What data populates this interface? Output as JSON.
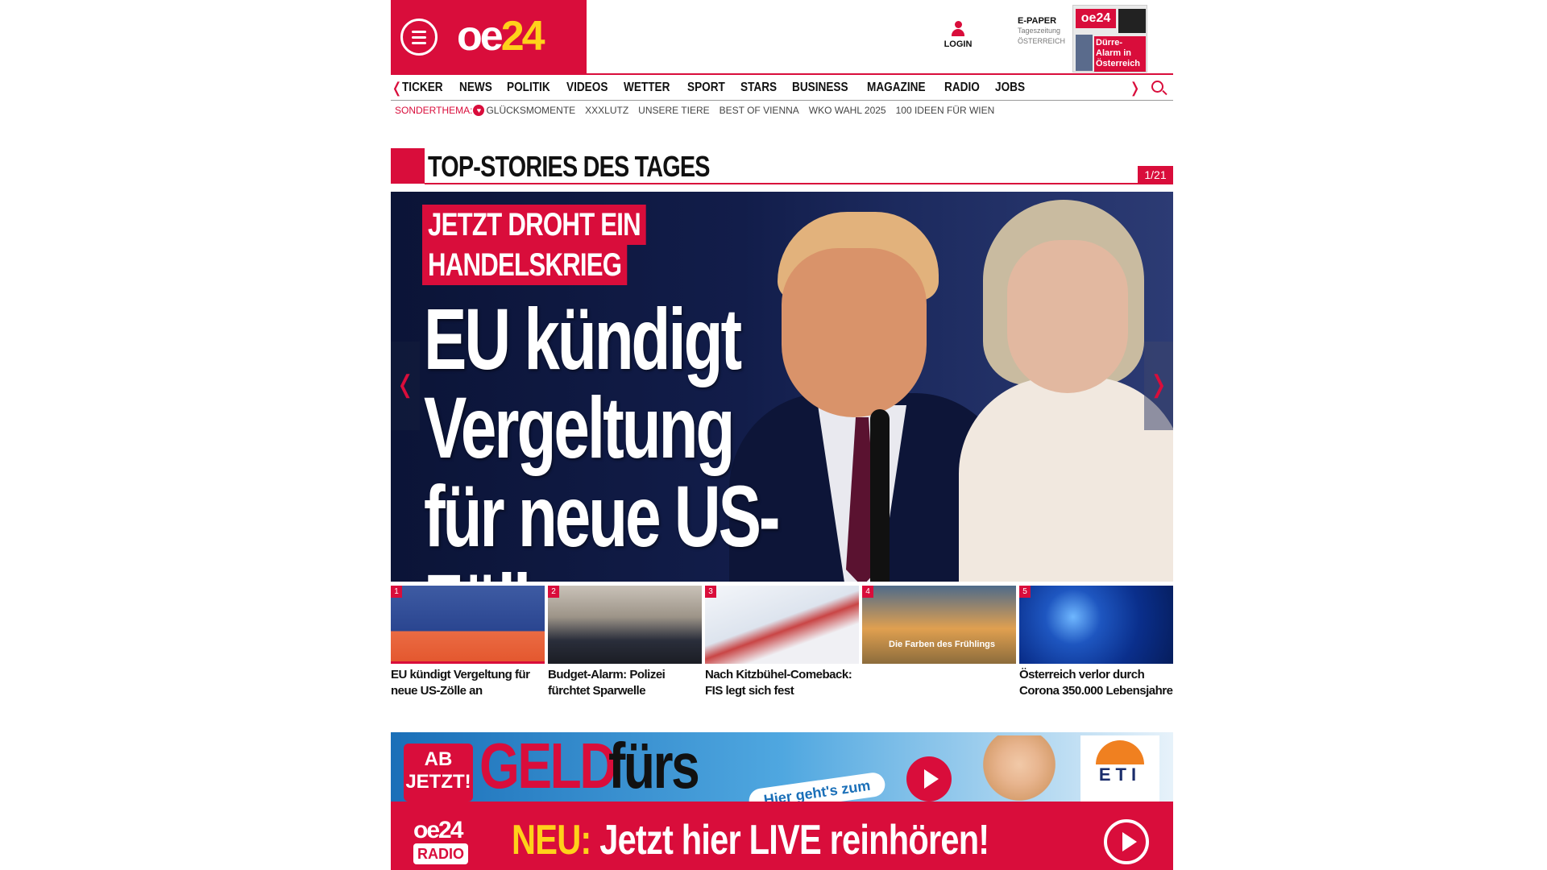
{
  "brand": {
    "logo_oe": "oe",
    "logo_24": "24"
  },
  "header": {
    "login_label": "LOGIN",
    "epaper": {
      "title": "E-PAPER",
      "line1": "Tageszeitung",
      "line2": "ÖSTERREICH",
      "cover_logo": "oe24",
      "cover_headline": "Dürre-Alarm in Österreich"
    }
  },
  "nav": {
    "items": [
      "TICKER",
      "NEWS",
      "POLITIK",
      "VIDEOS",
      "WETTER",
      "SPORT",
      "STARS",
      "BUSINESS",
      "MAGAZINE",
      "RADIO",
      "JOBS"
    ]
  },
  "subnav": {
    "label": "SONDERTHEMA:",
    "items": [
      "GLÜCKSMOMENTE",
      "XXXLUTZ",
      "UNSERE TIERE",
      "BEST OF VIENNA",
      "WKO WAHL 2025",
      "100 IDEEN FÜR WIEN"
    ]
  },
  "top_stories": {
    "title": "TOP-STORIES DES TAGES",
    "counter": "1/21",
    "hero": {
      "kicker_line1": "JETZT DROHT EIN",
      "kicker_line2": "HANDELSKRIEG",
      "headline": "EU kündigt Vergeltung für neue US-Zölle an"
    },
    "teasers": [
      {
        "num": "1",
        "caption": "EU kündigt Vergeltung für neue US-Zölle an",
        "image_text": ""
      },
      {
        "num": "2",
        "caption": "Budget-Alarm: Polizei fürchtet Sparwelle",
        "image_text": ""
      },
      {
        "num": "3",
        "caption": "Nach Kitzbühel-Comeback: FIS legt sich fest",
        "image_text": ""
      },
      {
        "num": "4",
        "caption": "",
        "image_text": "Die Farben des Frühlings"
      },
      {
        "num": "5",
        "caption": "Österreich verlor durch Corona 350.000 Lebensjahre",
        "image_text": ""
      }
    ]
  },
  "ads": {
    "ad1": {
      "badge": "AB JETZT!",
      "word1": "GELD",
      "word2": "fürs",
      "pill": "Hier geht's zum",
      "brand": "ETI"
    },
    "ad2": {
      "logo": "oe24",
      "logo_sub": "RADIO",
      "neu": "NEU:",
      "text": "Jetzt hier LIVE reinhören!"
    }
  },
  "colors": {
    "accent": "#d90d3b",
    "yellow": "#ffd11a"
  }
}
